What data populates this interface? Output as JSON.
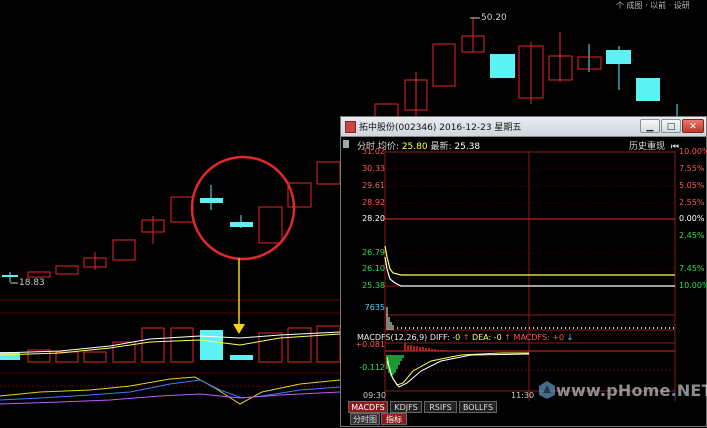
{
  "background": {
    "price_high_label": "50.20",
    "price_low_label": "18.83",
    "top_bar_text": "个  成图 · 以前 · 设研"
  },
  "popup": {
    "title": "拓中股份(002346)  2016-12-23 星期五",
    "window_buttons": {
      "minimize": "▁",
      "maximize": "□",
      "close": "✕"
    },
    "info": {
      "label_fenshi": "分时",
      "label_avg": "均价:",
      "avg_value": "25.80",
      "label_latest": "最新:",
      "latest_value": "25.38",
      "history_button": "历史重现",
      "history_icon": "rewind-icon"
    },
    "price_axis_left": [
      "31.02",
      "30.33",
      "29.61",
      "28.92",
      "28.20",
      "26.79",
      "26.10",
      "25.38"
    ],
    "price_axis_right": [
      "10.00%",
      "7.55%",
      "5.05%",
      "2.55%",
      "0.00%",
      "2.45%",
      "7.45%",
      "10.00%"
    ],
    "volume_label": "7635",
    "macd": {
      "name": "MACDFS(12,26,9)",
      "diff_label": "DIFF:",
      "diff_value": "-0",
      "diff_arrow": "↑",
      "dea_label": "DEA:",
      "dea_value": "-0",
      "dea_arrow": "↑",
      "macdfs_label": "MACDFS:",
      "macdfs_value": "+0",
      "macdfs_arrow": "↓",
      "axis_top": "+0.081",
      "axis_bottom": "-0.112"
    },
    "time_labels": [
      "09:30",
      "11:30"
    ],
    "indicator_tabs": [
      "MACDFS",
      "KDJFS",
      "RSIFS",
      "BOLLFS"
    ],
    "view_tabs": [
      "分时图",
      "指标"
    ]
  },
  "watermark": {
    "text_a": "www.pHome",
    "text_dot": ".",
    "text_b": "NET"
  },
  "colors": {
    "up": "#e8262d",
    "down": "#5cf2f4",
    "avg_line": "#ffff55",
    "price_line": "#ffffff",
    "circle": "#e02a2a",
    "arrow": "#f5d21a"
  }
}
